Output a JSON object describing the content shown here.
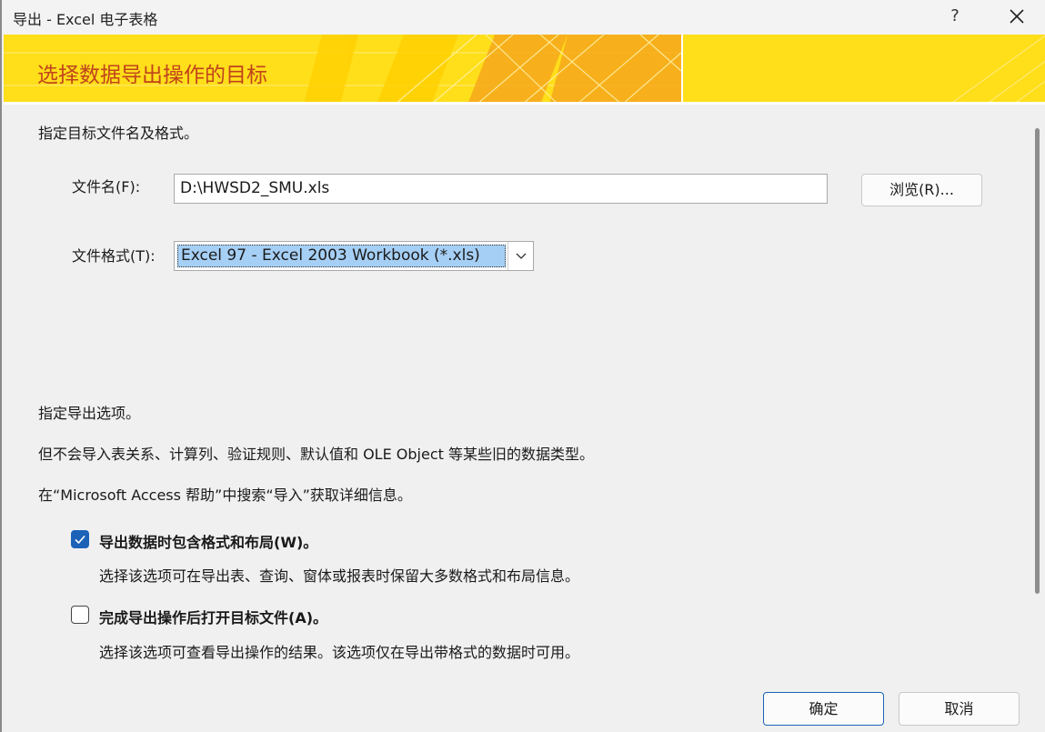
{
  "window": {
    "title": "导出 - Excel 电子表格",
    "help_label": "?"
  },
  "banner": {
    "heading": "选择数据导出操作的目标"
  },
  "target": {
    "intro": "指定目标文件名及格式。",
    "filename_label": "文件名(F):",
    "filename_value": "D:\\HWSD2_SMU.xls",
    "browse_label": "浏览(R)...",
    "format_label": "文件格式(T):",
    "format_selected": "Excel 97 - Excel 2003 Workbook (*.xls)"
  },
  "options": {
    "intro": "指定导出选项。",
    "note1": "但不会导入表关系、计算列、验证规则、默认值和 OLE Object 等某些旧的数据类型。",
    "note2": "在“Microsoft Access 帮助”中搜索“导入”获取详细信息。",
    "items": [
      {
        "label": "导出数据时包含格式和布局(W)。",
        "description": "选择该选项可在导出表、查询、窗体或报表时保留大多数格式和布局信息。",
        "checked": true
      },
      {
        "label": "完成导出操作后打开目标文件(A)。",
        "description": "选择该选项可查看导出操作的结果。该选项仅在导出带格式的数据时可用。",
        "checked": false
      }
    ]
  },
  "footer": {
    "ok_label": "确定",
    "cancel_label": "取消"
  },
  "colors": {
    "banner_yellow": "#ffde1a",
    "banner_orange": "#f6a81c",
    "heading_text": "#c0441c",
    "checkbox_accent": "#1c63b8",
    "selection_highlight": "#a6cff5"
  }
}
